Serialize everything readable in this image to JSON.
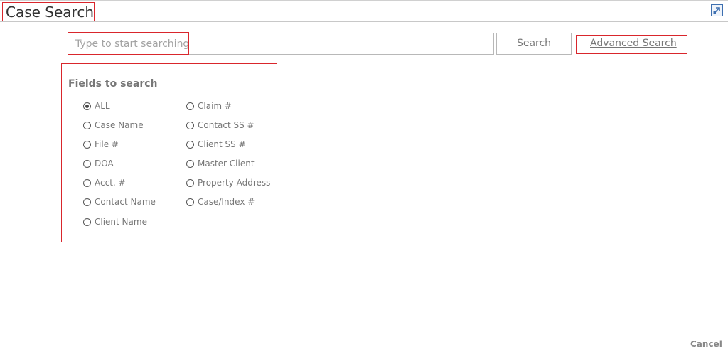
{
  "dialog": {
    "title": "Case Search"
  },
  "search": {
    "placeholder": "Type to start searching",
    "value": "",
    "button_label": "Search",
    "advanced_label": "Advanced Search"
  },
  "fields": {
    "title": "Fields to search",
    "left_column": [
      {
        "label": "ALL",
        "checked": true
      },
      {
        "label": "Case Name",
        "checked": false
      },
      {
        "label": "File #",
        "checked": false
      },
      {
        "label": "DOA",
        "checked": false
      },
      {
        "label": "Acct. #",
        "checked": false
      },
      {
        "label": "Contact Name",
        "checked": false
      },
      {
        "label": "Client Name",
        "checked": false
      }
    ],
    "right_column": [
      {
        "label": "Claim #",
        "checked": false
      },
      {
        "label": "Contact SS #",
        "checked": false
      },
      {
        "label": "Client SS #",
        "checked": false
      },
      {
        "label": "Master Client",
        "checked": false
      },
      {
        "label": "Property Address",
        "checked": false
      },
      {
        "label": "Case/Index #",
        "checked": false
      }
    ]
  },
  "footer": {
    "cancel_label": "Cancel"
  },
  "icons": {
    "expand": "expand-icon"
  },
  "colors": {
    "highlight": "#d9262c",
    "expand_icon": "#3d6fb0"
  }
}
